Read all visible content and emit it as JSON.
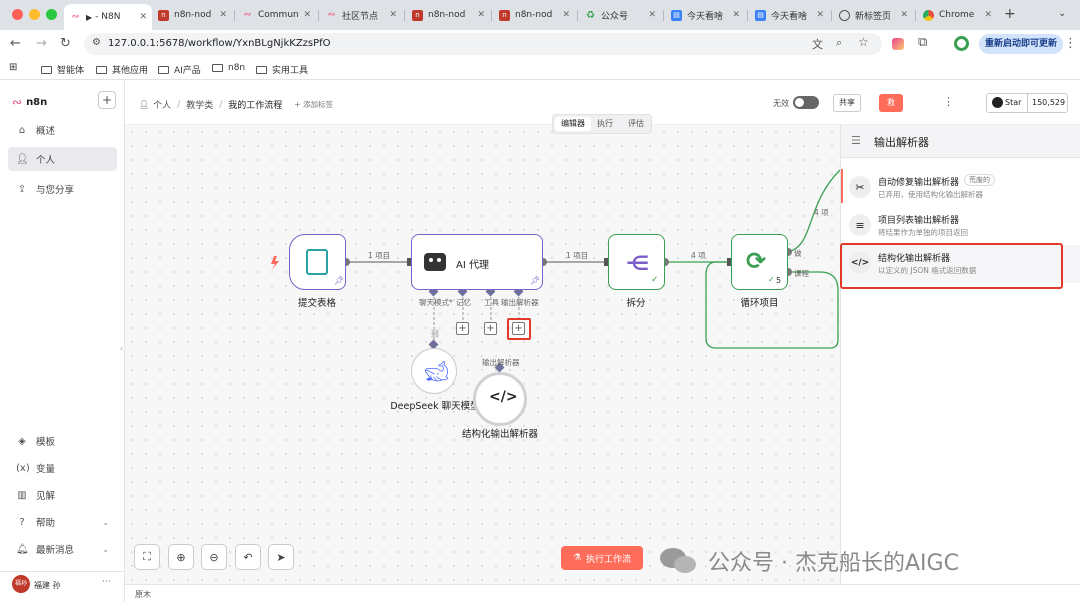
{
  "browser": {
    "tabs": [
      {
        "label": "- N8N",
        "favicon": "n8n-icon",
        "color": "#ea4b71"
      },
      {
        "label": "n8n-nod",
        "favicon": "n-icon",
        "color": "#c0392b"
      },
      {
        "label": "Commun",
        "favicon": "n8n-icon",
        "color": "#ea4b71"
      },
      {
        "label": "社区节点",
        "favicon": "n8n-icon",
        "color": "#ea4b71"
      },
      {
        "label": "n8n-nod",
        "favicon": "n-icon",
        "color": "#c0392b"
      },
      {
        "label": "n8n-nod",
        "favicon": "n-icon",
        "color": "#c0392b"
      },
      {
        "label": "公众号",
        "favicon": "recycle-icon",
        "color": "#2ea44f"
      },
      {
        "label": "今天看啥",
        "favicon": "doc-icon",
        "color": "#3b82f6"
      },
      {
        "label": "今天看啥",
        "favicon": "doc-icon",
        "color": "#3b82f6"
      },
      {
        "label": "新标签页",
        "favicon": "chrome-icon",
        "color": "#666666"
      },
      {
        "label": "Chrome",
        "favicon": "chrome-icon",
        "color": "#e74c3c"
      }
    ],
    "url": "127.0.0.1:5678/workflow/YxnBLgNjkKZzsPfO",
    "update_button": "重新启动即可更新",
    "bookmarks": [
      "智能体",
      "其他应用",
      "AI产品",
      "n8n",
      "实用工具"
    ]
  },
  "sidebar": {
    "logo": "n8n",
    "add_symbol": "+",
    "items": [
      {
        "label": "概述",
        "icon": "home-icon"
      },
      {
        "label": "个人",
        "icon": "user-icon"
      },
      {
        "label": "与您分享",
        "icon": "share-icon"
      }
    ],
    "bottom_items": [
      {
        "label": "模板",
        "icon": "templates-icon"
      },
      {
        "label": "变量",
        "icon": "variables-icon"
      },
      {
        "label": "见解",
        "icon": "insights-icon"
      },
      {
        "label": "帮助",
        "icon": "help-icon"
      },
      {
        "label": "最新消息",
        "icon": "bell-icon"
      }
    ],
    "user": {
      "name": "福建 孙",
      "avatar_text": "福孙",
      "more": "···"
    }
  },
  "topbar": {
    "breadcrumb": [
      "个人",
      "教学类",
      "我的工作流程"
    ],
    "add_tag": "+ 添加标签",
    "active_label": "无效",
    "share_button": "共享",
    "save_button": "救",
    "more": "⋮",
    "github_star": "Star",
    "star_count": "150,529",
    "tabs": [
      "编辑器",
      "执行",
      "评估"
    ]
  },
  "canvas": {
    "nodes": {
      "form": "提交表格",
      "agent": "AI 代理",
      "split": "拆分",
      "loop": "循环项目",
      "deepseek": "DeepSeek 聊天模型",
      "parser": "结构化输出解析器"
    },
    "connections": {
      "form_agent": "1 项目",
      "agent_split": "1 项目",
      "split_loop": "4 项",
      "loop_done": "4 项",
      "loop_done_label": "做",
      "loop_label": "课程",
      "loop_count": "5"
    },
    "sub_ports": [
      "聊天模式*",
      "记忆",
      "工具",
      "输出解析器"
    ],
    "parser_port_label": "输出解析器",
    "execute_button": "执行工作流",
    "footer": "原木"
  },
  "panel": {
    "title": "输出解析器",
    "items": [
      {
        "title": "自动修复输出解析器",
        "badge": "荒废的",
        "desc": "已弃用，使用结构化输出解析器",
        "icon": "tools-icon"
      },
      {
        "title": "项目列表输出解析器",
        "desc": "将结果作为单独的项目返回",
        "icon": "list-icon"
      },
      {
        "title": "结构化输出解析器",
        "desc": "以定义的 JSON 格式返回数据",
        "icon": "code-icon"
      }
    ]
  },
  "watermark": "公众号 · 杰克船长的AIGC",
  "colors": {
    "accent": "#ff6d5a",
    "agent_border": "#7b5fc9",
    "success": "#3a9f53",
    "highlight": "#e23a2a"
  }
}
